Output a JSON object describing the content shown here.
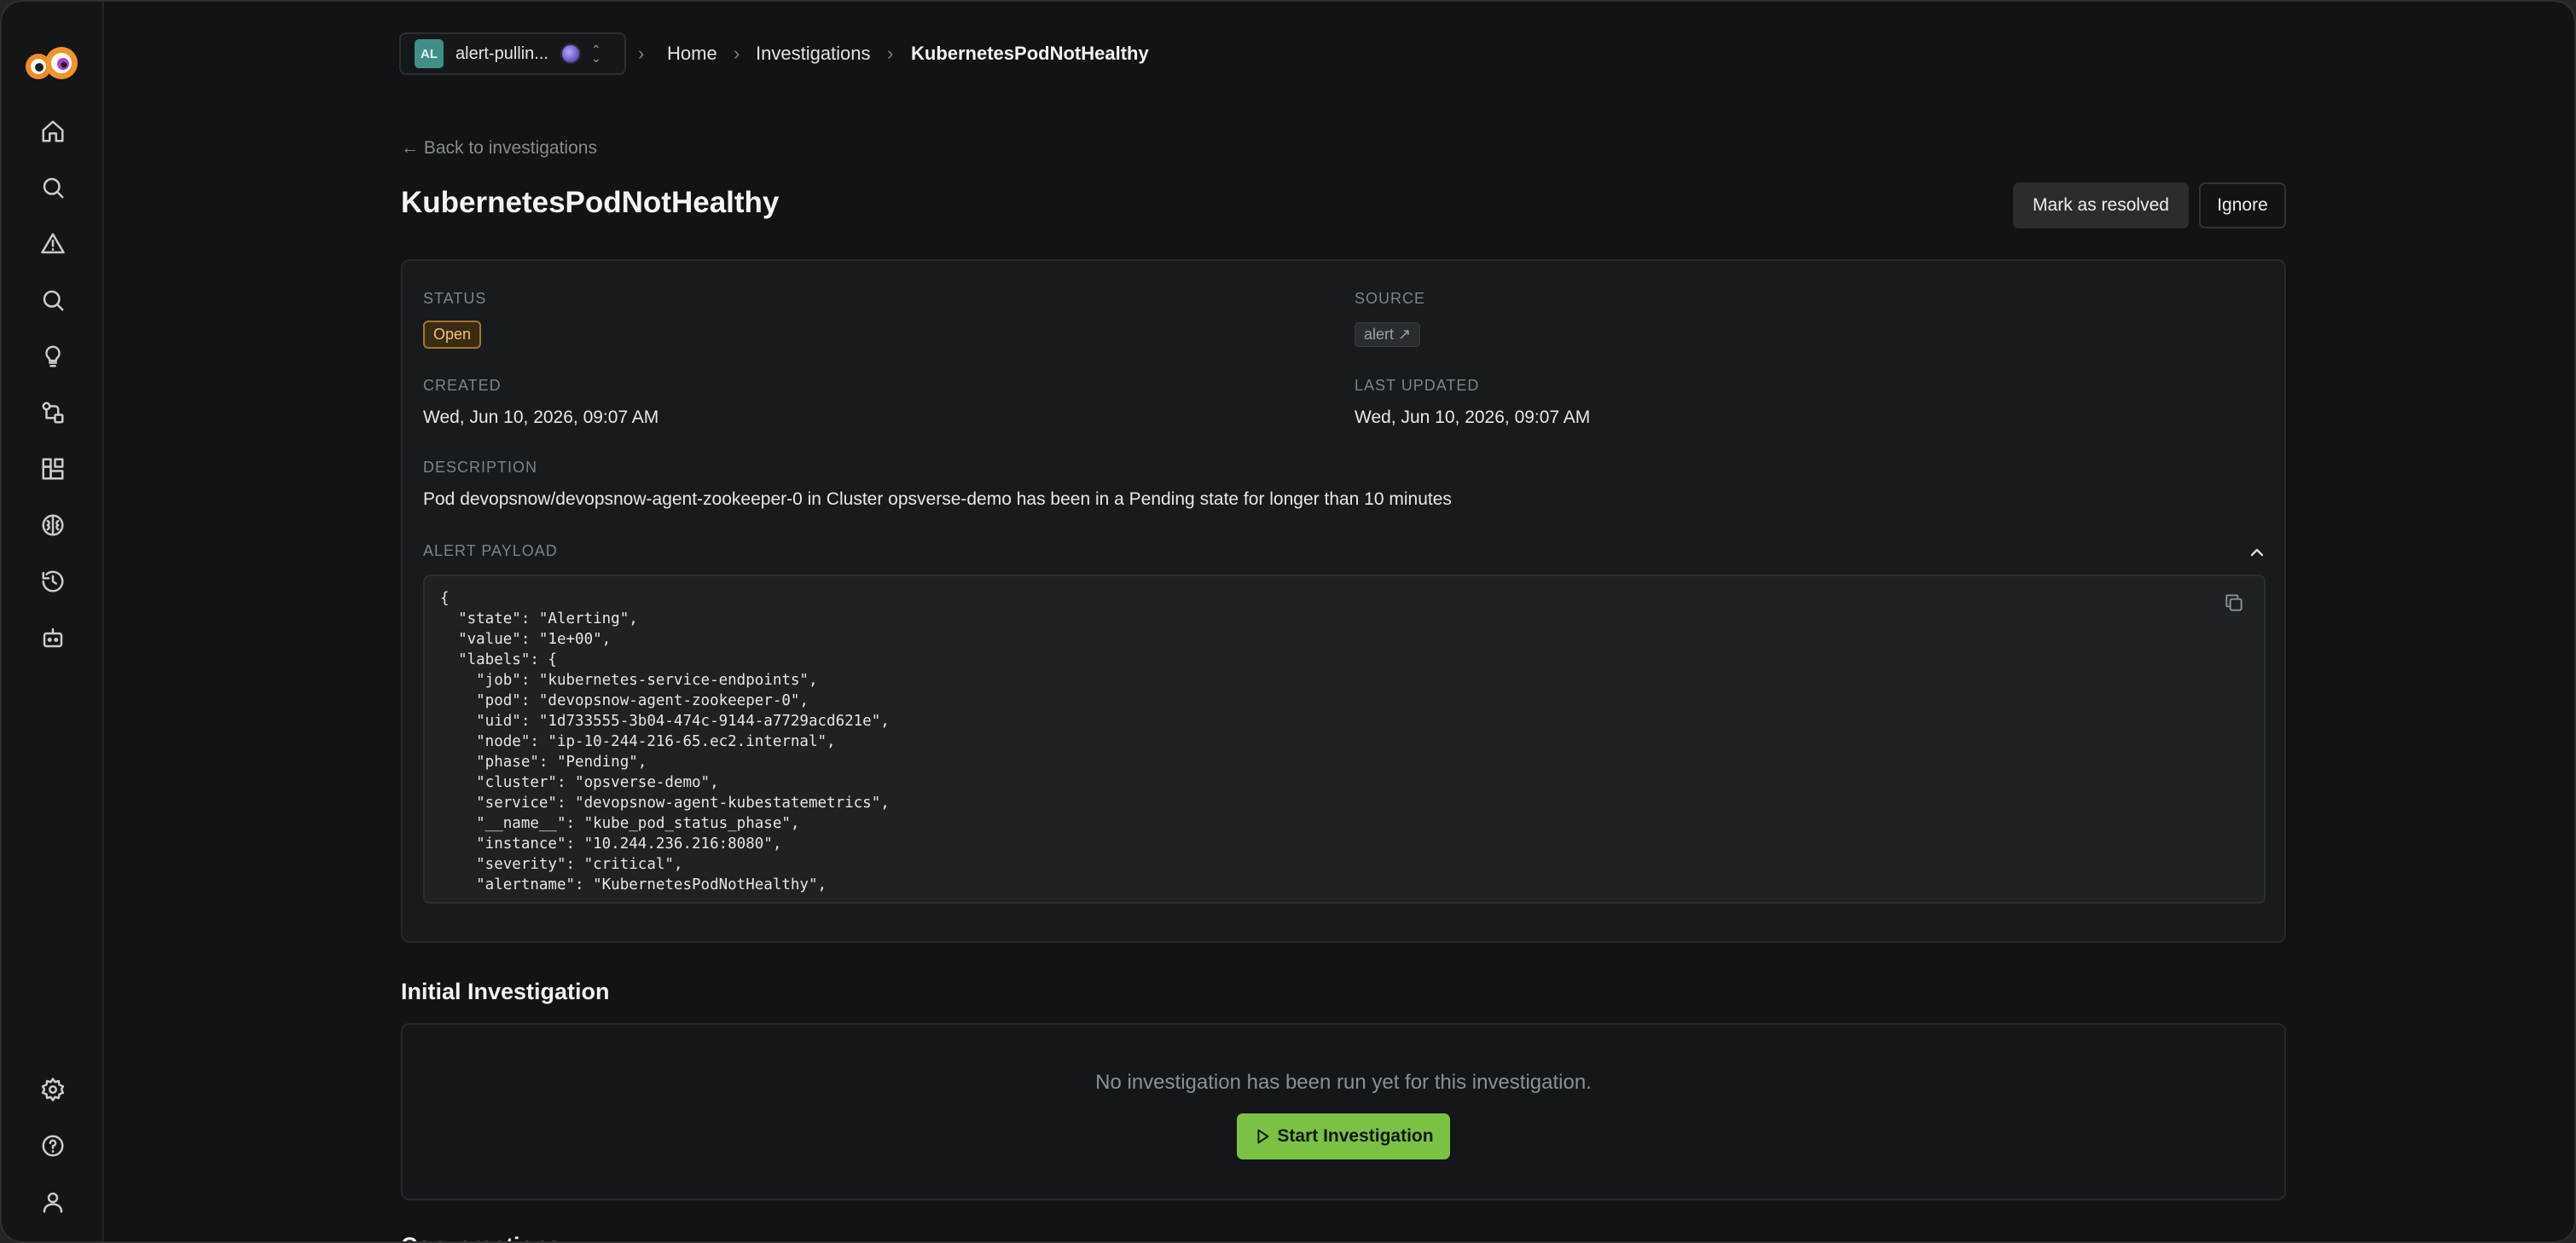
{
  "app": {
    "name": "OpsVerse",
    "accent": "#7bc144"
  },
  "workspace": {
    "initials": "AL",
    "name": "alert-pullin..."
  },
  "breadcrumb": {
    "home": "Home",
    "investigations": "Investigations",
    "current": "KubernetesPodNotHealthy"
  },
  "header": {
    "back_label": "Back to investigations",
    "title": "KubernetesPodNotHealthy",
    "resolve_label": "Mark as resolved",
    "ignore_label": "Ignore"
  },
  "details": {
    "status_label": "STATUS",
    "status_value": "Open",
    "source_label": "SOURCE",
    "source_value": "alert",
    "created_label": "CREATED",
    "created_value": "Wed, Jun 10, 2026, 09:07 AM",
    "updated_label": "LAST UPDATED",
    "updated_value": "Wed, Jun 10, 2026, 09:07 AM",
    "description_label": "DESCRIPTION",
    "description_value": "Pod devopsnow/devopsnow-agent-zookeeper-0 in Cluster opsverse-demo has been in a Pending state for longer than 10 minutes",
    "payload_label": "ALERT PAYLOAD",
    "payload_text": "{\n  \"state\": \"Alerting\",\n  \"value\": \"1e+00\",\n  \"labels\": {\n    \"job\": \"kubernetes-service-endpoints\",\n    \"pod\": \"devopsnow-agent-zookeeper-0\",\n    \"uid\": \"1d733555-3b04-474c-9144-a7729acd621e\",\n    \"node\": \"ip-10-244-216-65.ec2.internal\",\n    \"phase\": \"Pending\",\n    \"cluster\": \"opsverse-demo\",\n    \"service\": \"devopsnow-agent-kubestatemetrics\",\n    \"__name__\": \"kube_pod_status_phase\",\n    \"instance\": \"10.244.236.216:8080\",\n    \"severity\": \"critical\",\n    \"alertname\": \"KubernetesPodNotHealthy\","
  },
  "initial_investigation": {
    "title": "Initial Investigation",
    "empty_text": "No investigation has been run yet for this investigation.",
    "start_label": "Start Investigation"
  },
  "conversations": {
    "title": "Conversations"
  },
  "sidebar": {
    "items": [
      {
        "icon": "home-icon"
      },
      {
        "icon": "search-icon"
      },
      {
        "icon": "alert-icon"
      },
      {
        "icon": "investigations-search-icon"
      },
      {
        "icon": "lightbulb-icon"
      },
      {
        "icon": "workflow-icon"
      },
      {
        "icon": "integrations-icon"
      },
      {
        "icon": "brain-icon"
      },
      {
        "icon": "history-icon"
      },
      {
        "icon": "bot-icon"
      },
      {
        "icon": "settings-icon"
      },
      {
        "icon": "help-icon"
      },
      {
        "icon": "user-icon"
      }
    ]
  }
}
